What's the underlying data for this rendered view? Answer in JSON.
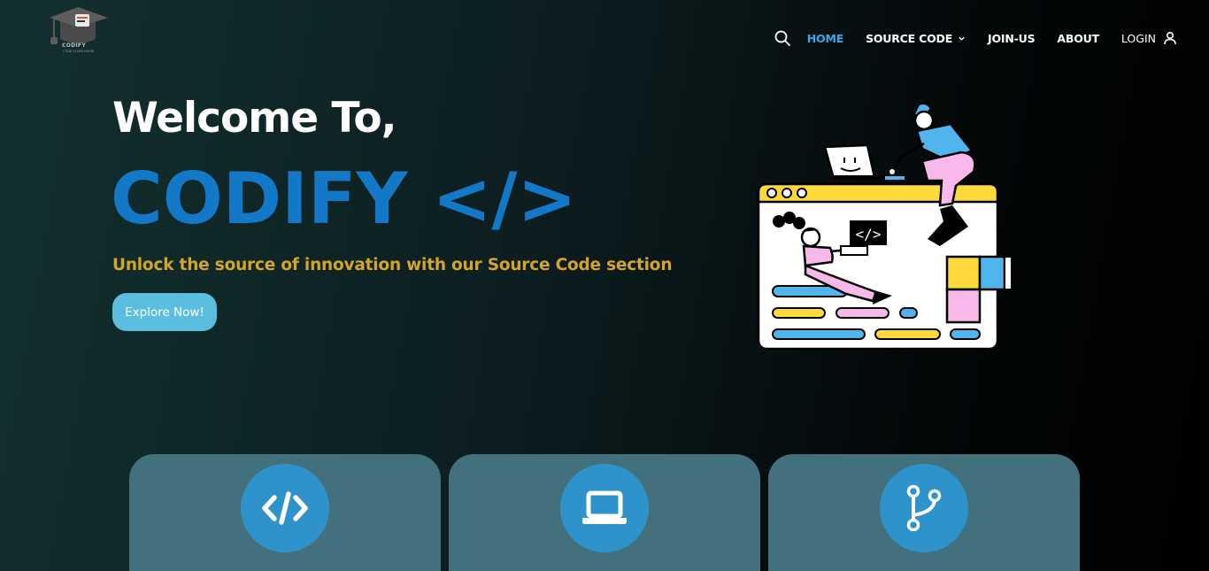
{
  "brand": {
    "logo_text": "CODIFY",
    "logo_sub": "CODE LEARN GROW"
  },
  "nav": {
    "search_icon": "search-icon",
    "items": [
      {
        "label": "HOME",
        "active": true
      },
      {
        "label": "SOURCE CODE",
        "has_dropdown": true
      },
      {
        "label": "JOIN-US"
      },
      {
        "label": "ABOUT"
      }
    ],
    "login_label": "LOGIN",
    "login_icon": "user-icon"
  },
  "hero": {
    "welcome": "Welcome To,",
    "brand": "CODIFY </>",
    "subtitle": "Unlock the source of innovation with our Source Code section",
    "cta": "Explore Now!"
  },
  "cards": [
    {
      "icon": "code-icon"
    },
    {
      "icon": "laptop-icon"
    },
    {
      "icon": "git-branch-icon"
    }
  ],
  "colors": {
    "accent": "#1478c8",
    "nav_active": "#38a9e6",
    "subtitle": "#d5a42a",
    "button": "#5bbedf",
    "card_bg": "#42707c",
    "card_icon_bg": "#2e93ca"
  },
  "illustration": {
    "code_tag": "</>"
  }
}
